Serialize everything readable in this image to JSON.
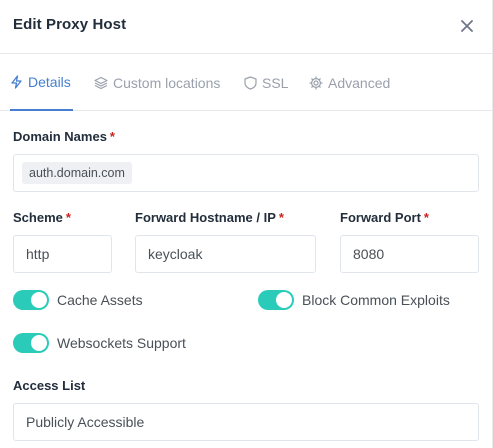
{
  "header": {
    "title": "Edit Proxy Host"
  },
  "tabs": [
    {
      "label": "Details",
      "icon": "lightning-icon",
      "active": true
    },
    {
      "label": "Custom locations",
      "icon": "layers-icon",
      "active": false
    },
    {
      "label": "SSL",
      "icon": "shield-icon",
      "active": false
    },
    {
      "label": "Advanced",
      "icon": "gear-icon",
      "active": false
    }
  ],
  "form": {
    "domain_names": {
      "label": "Domain Names",
      "required": "*",
      "values": [
        "auth.domain.com"
      ]
    },
    "scheme": {
      "label": "Scheme",
      "required": "*",
      "value": "http"
    },
    "forward_host": {
      "label": "Forward Hostname / IP",
      "required": "*",
      "value": "keycloak"
    },
    "forward_port": {
      "label": "Forward Port",
      "required": "*",
      "value": "8080"
    },
    "toggles": {
      "cache_assets": {
        "label": "Cache Assets",
        "on": true
      },
      "block_exploits": {
        "label": "Block Common Exploits",
        "on": true
      },
      "websockets": {
        "label": "Websockets Support",
        "on": true
      }
    },
    "access_list": {
      "label": "Access List",
      "value": "Publicly Accessible"
    }
  },
  "colors": {
    "accent": "#467fcf",
    "toggle_on": "#2bcbba",
    "required": "#cd201f"
  }
}
